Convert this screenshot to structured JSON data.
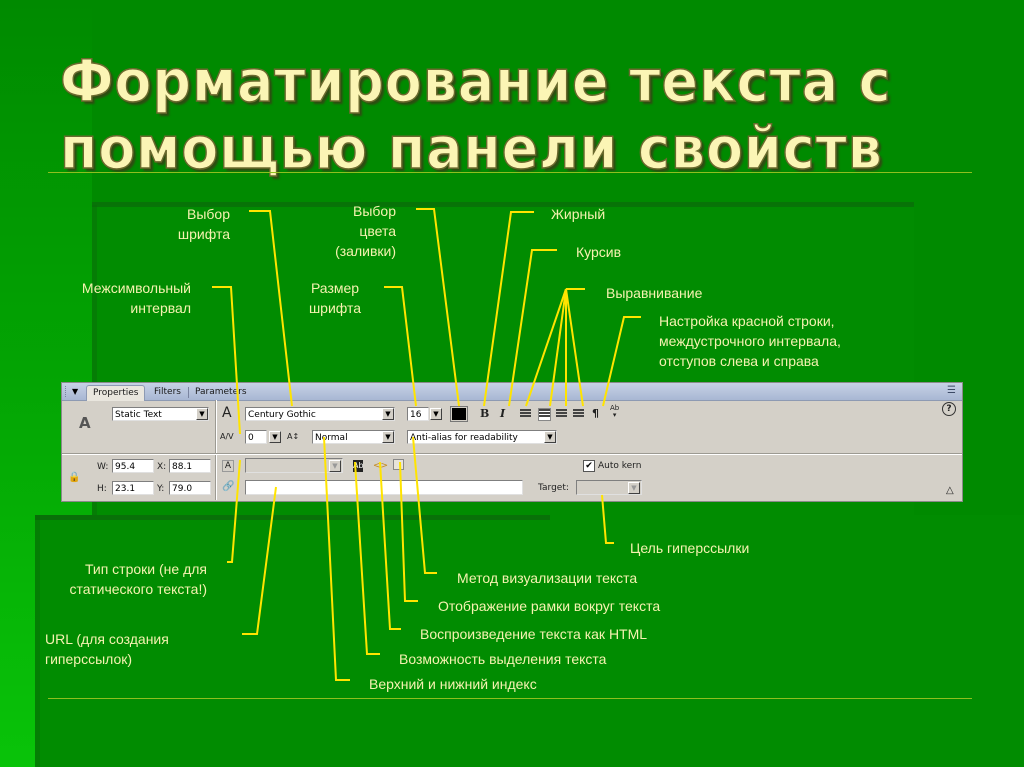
{
  "slide": {
    "title_line1": "Форматирование текста с",
    "title_line2": "помощью панели свойств",
    "colors": {
      "background": "#008a00",
      "title": "#fbf5b5",
      "label_text": "#f5f2b0",
      "leader_lines": "#ffe400"
    }
  },
  "annotations": {
    "font_select": [
      "Выбор",
      "шрифта"
    ],
    "fill_color": [
      "Выбор",
      "цвета",
      "(заливки)"
    ],
    "bold": "Жирный",
    "italic": "Курсив",
    "alignment": "Выравнивание",
    "paragraph": [
      "Настройка красной строки,",
      "междустрочного интервала,",
      "отступов слева и справа"
    ],
    "letter_spacing": [
      "Межсимвольный",
      "интервал"
    ],
    "font_size": [
      "Размер",
      "шрифта"
    ],
    "line_type": [
      "Тип строки (не для",
      "статического текста!)"
    ],
    "url": [
      "URL (для создания",
      "гиперссылок)"
    ],
    "link_target": "Цель гиперссылки",
    "render_method": "Метод визуализации текста",
    "show_border": "Отображение рамки вокруг текста",
    "render_html": "Воспроизведение текста как HTML",
    "selectable": "Возможность выделения текста",
    "superscript": "Верхний и нижний индекс"
  },
  "panel": {
    "tabs": [
      "Properties",
      "Filters",
      "Parameters"
    ],
    "active_tab": "Properties",
    "text_type": "Static Text",
    "font_family": "Century Gothic",
    "font_size": "16",
    "letter_spacing": "0",
    "char_position": "Normal",
    "anti_alias": "Anti-alias for readability",
    "width_label": "W:",
    "width": "95.4",
    "height_label": "H:",
    "height": "23.1",
    "x_label": "X:",
    "x": "88.1",
    "y_label": "Y:",
    "y": "79.0",
    "auto_kern_label": "Auto kern",
    "auto_kern_checked": true,
    "target_label": "Target:",
    "url_value": "",
    "target_value": "",
    "fill_color": "#000000",
    "icons": {
      "text_tool": "A",
      "font": "A",
      "tracking": "A/V",
      "char_pos": "A↕",
      "bold": "B",
      "italic": "I",
      "paragraph": "¶",
      "help": "?",
      "lock": "🔒",
      "collapse": "△"
    }
  }
}
